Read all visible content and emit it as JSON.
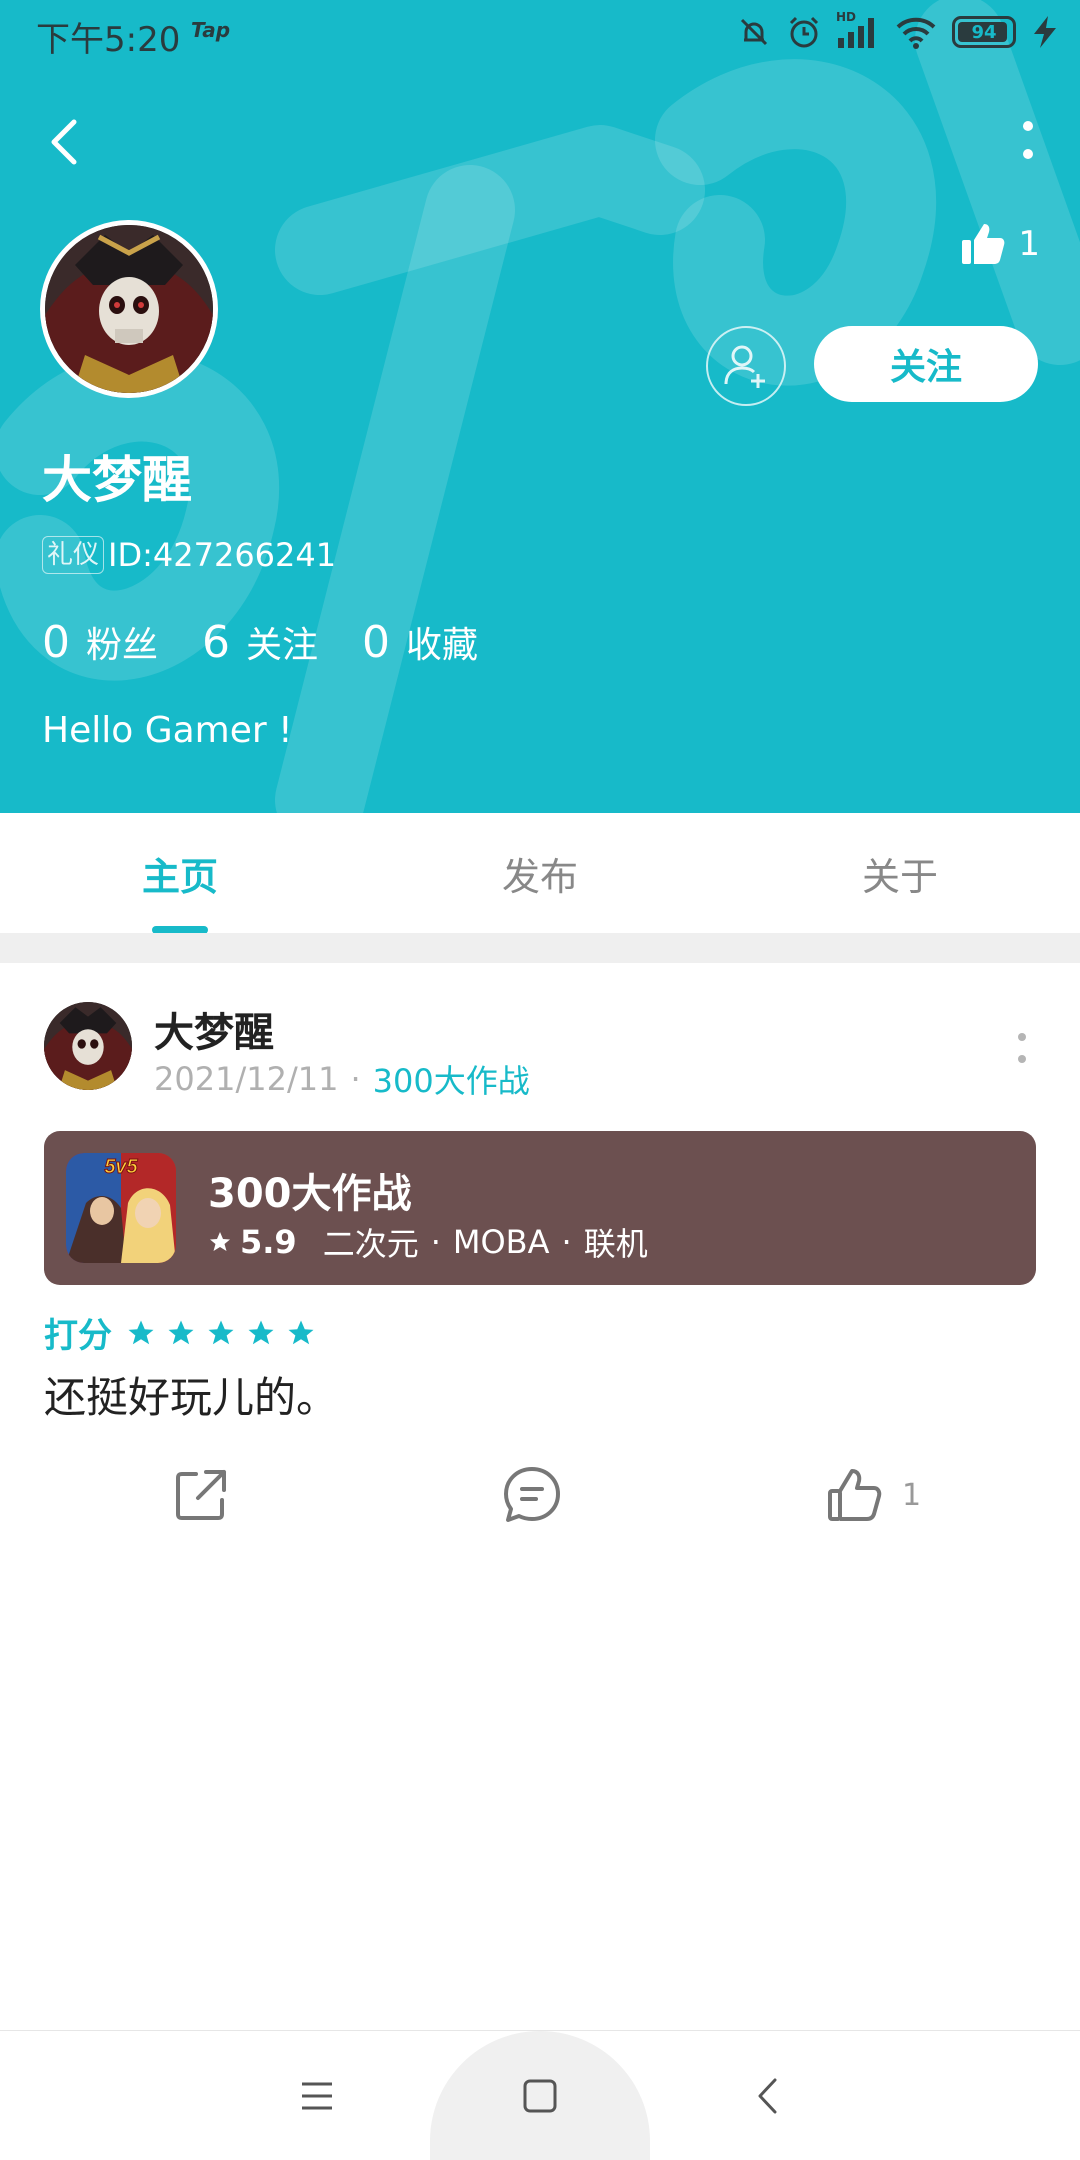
{
  "status_bar": {
    "time": "下午5:20",
    "app_badge": "Tap",
    "signal_tag": "HD",
    "battery": "94",
    "battery_level": 0.94,
    "icons": [
      "mute-icon",
      "alarm-icon",
      "signal-icon",
      "wifi-icon",
      "battery-icon",
      "charging-icon"
    ]
  },
  "profile": {
    "likes": "1",
    "follow_label": "关注",
    "name": "大梦醒",
    "badge": "礼仪",
    "id_text": "ID:427266241",
    "stats": [
      {
        "num": "0",
        "label": "粉丝"
      },
      {
        "num": "6",
        "label": "关注"
      },
      {
        "num": "0",
        "label": "收藏"
      }
    ],
    "bio": "Hello Gamer !"
  },
  "tabs": [
    "主页",
    "发布",
    "关于"
  ],
  "active_tab": 0,
  "post": {
    "author": "大梦醒",
    "date": "2021/12/11",
    "separator": "·",
    "game_link": "300大作战",
    "game_card": {
      "title": "300大作战",
      "score": "5.9",
      "tags": [
        "二次元",
        "MOBA",
        "联机"
      ],
      "icon_label": "5v5"
    },
    "rating_label": "打分",
    "stars": 5,
    "text": "还挺好玩儿的。",
    "like_count": "1"
  },
  "colors": {
    "accent": "#17bac9",
    "card_bg": "#6c5050",
    "divider": "#efefef"
  }
}
